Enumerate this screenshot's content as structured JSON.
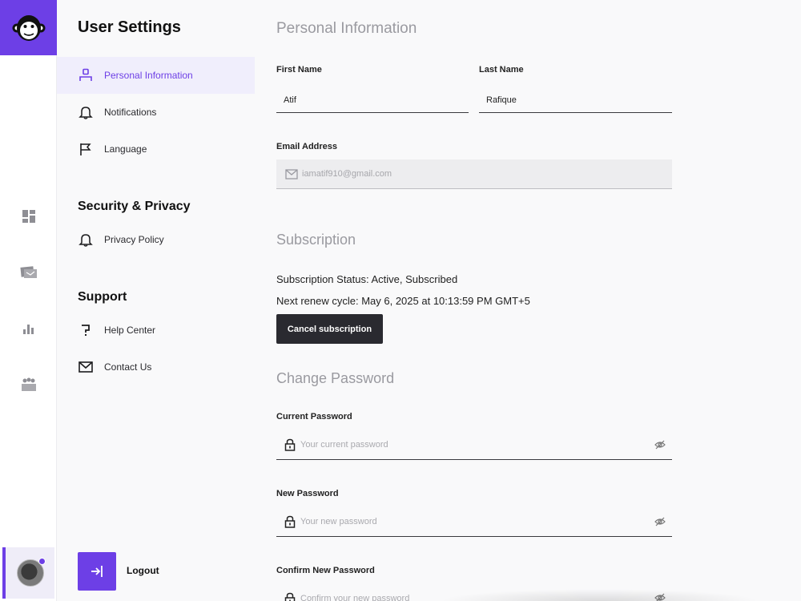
{
  "sidebar": {
    "title": "User Settings",
    "items": [
      {
        "label": "Personal Information",
        "icon": "person-icon",
        "active": true
      },
      {
        "label": "Notifications",
        "icon": "bell-icon"
      },
      {
        "label": "Language",
        "icon": "flag-icon"
      }
    ],
    "security_title": "Security & Privacy",
    "security_items": [
      {
        "label": "Privacy Policy",
        "icon": "bell-icon"
      }
    ],
    "support_title": "Support",
    "support_items": [
      {
        "label": "Help Center",
        "icon": "question-icon"
      },
      {
        "label": "Contact Us",
        "icon": "mail-icon"
      }
    ],
    "logout_label": "Logout"
  },
  "rail": {
    "icons": [
      "dashboard-icon",
      "tickets-icon",
      "bar-chart-icon",
      "team-icon"
    ],
    "accent": "#6d3fe6"
  },
  "personal": {
    "title": "Personal Information",
    "first_name_label": "First Name",
    "first_name_value": "Atif",
    "last_name_label": "Last Name",
    "last_name_value": "Rafique",
    "email_label": "Email Address",
    "email_value": "iamatif910@gmail.com"
  },
  "subscription": {
    "title": "Subscription",
    "status": "Subscription Status: Active, Subscribed",
    "renew": "Next renew cycle: May 6, 2025 at 10:13:59 PM GMT+5",
    "cancel_label": "Cancel subscription"
  },
  "password": {
    "title": "Change Password",
    "current_label": "Current Password",
    "current_placeholder": "Your current password",
    "new_label": "New Password",
    "new_placeholder": "Your new password",
    "confirm_label": "Confirm New Password",
    "confirm_placeholder": "Confirm your new password"
  }
}
